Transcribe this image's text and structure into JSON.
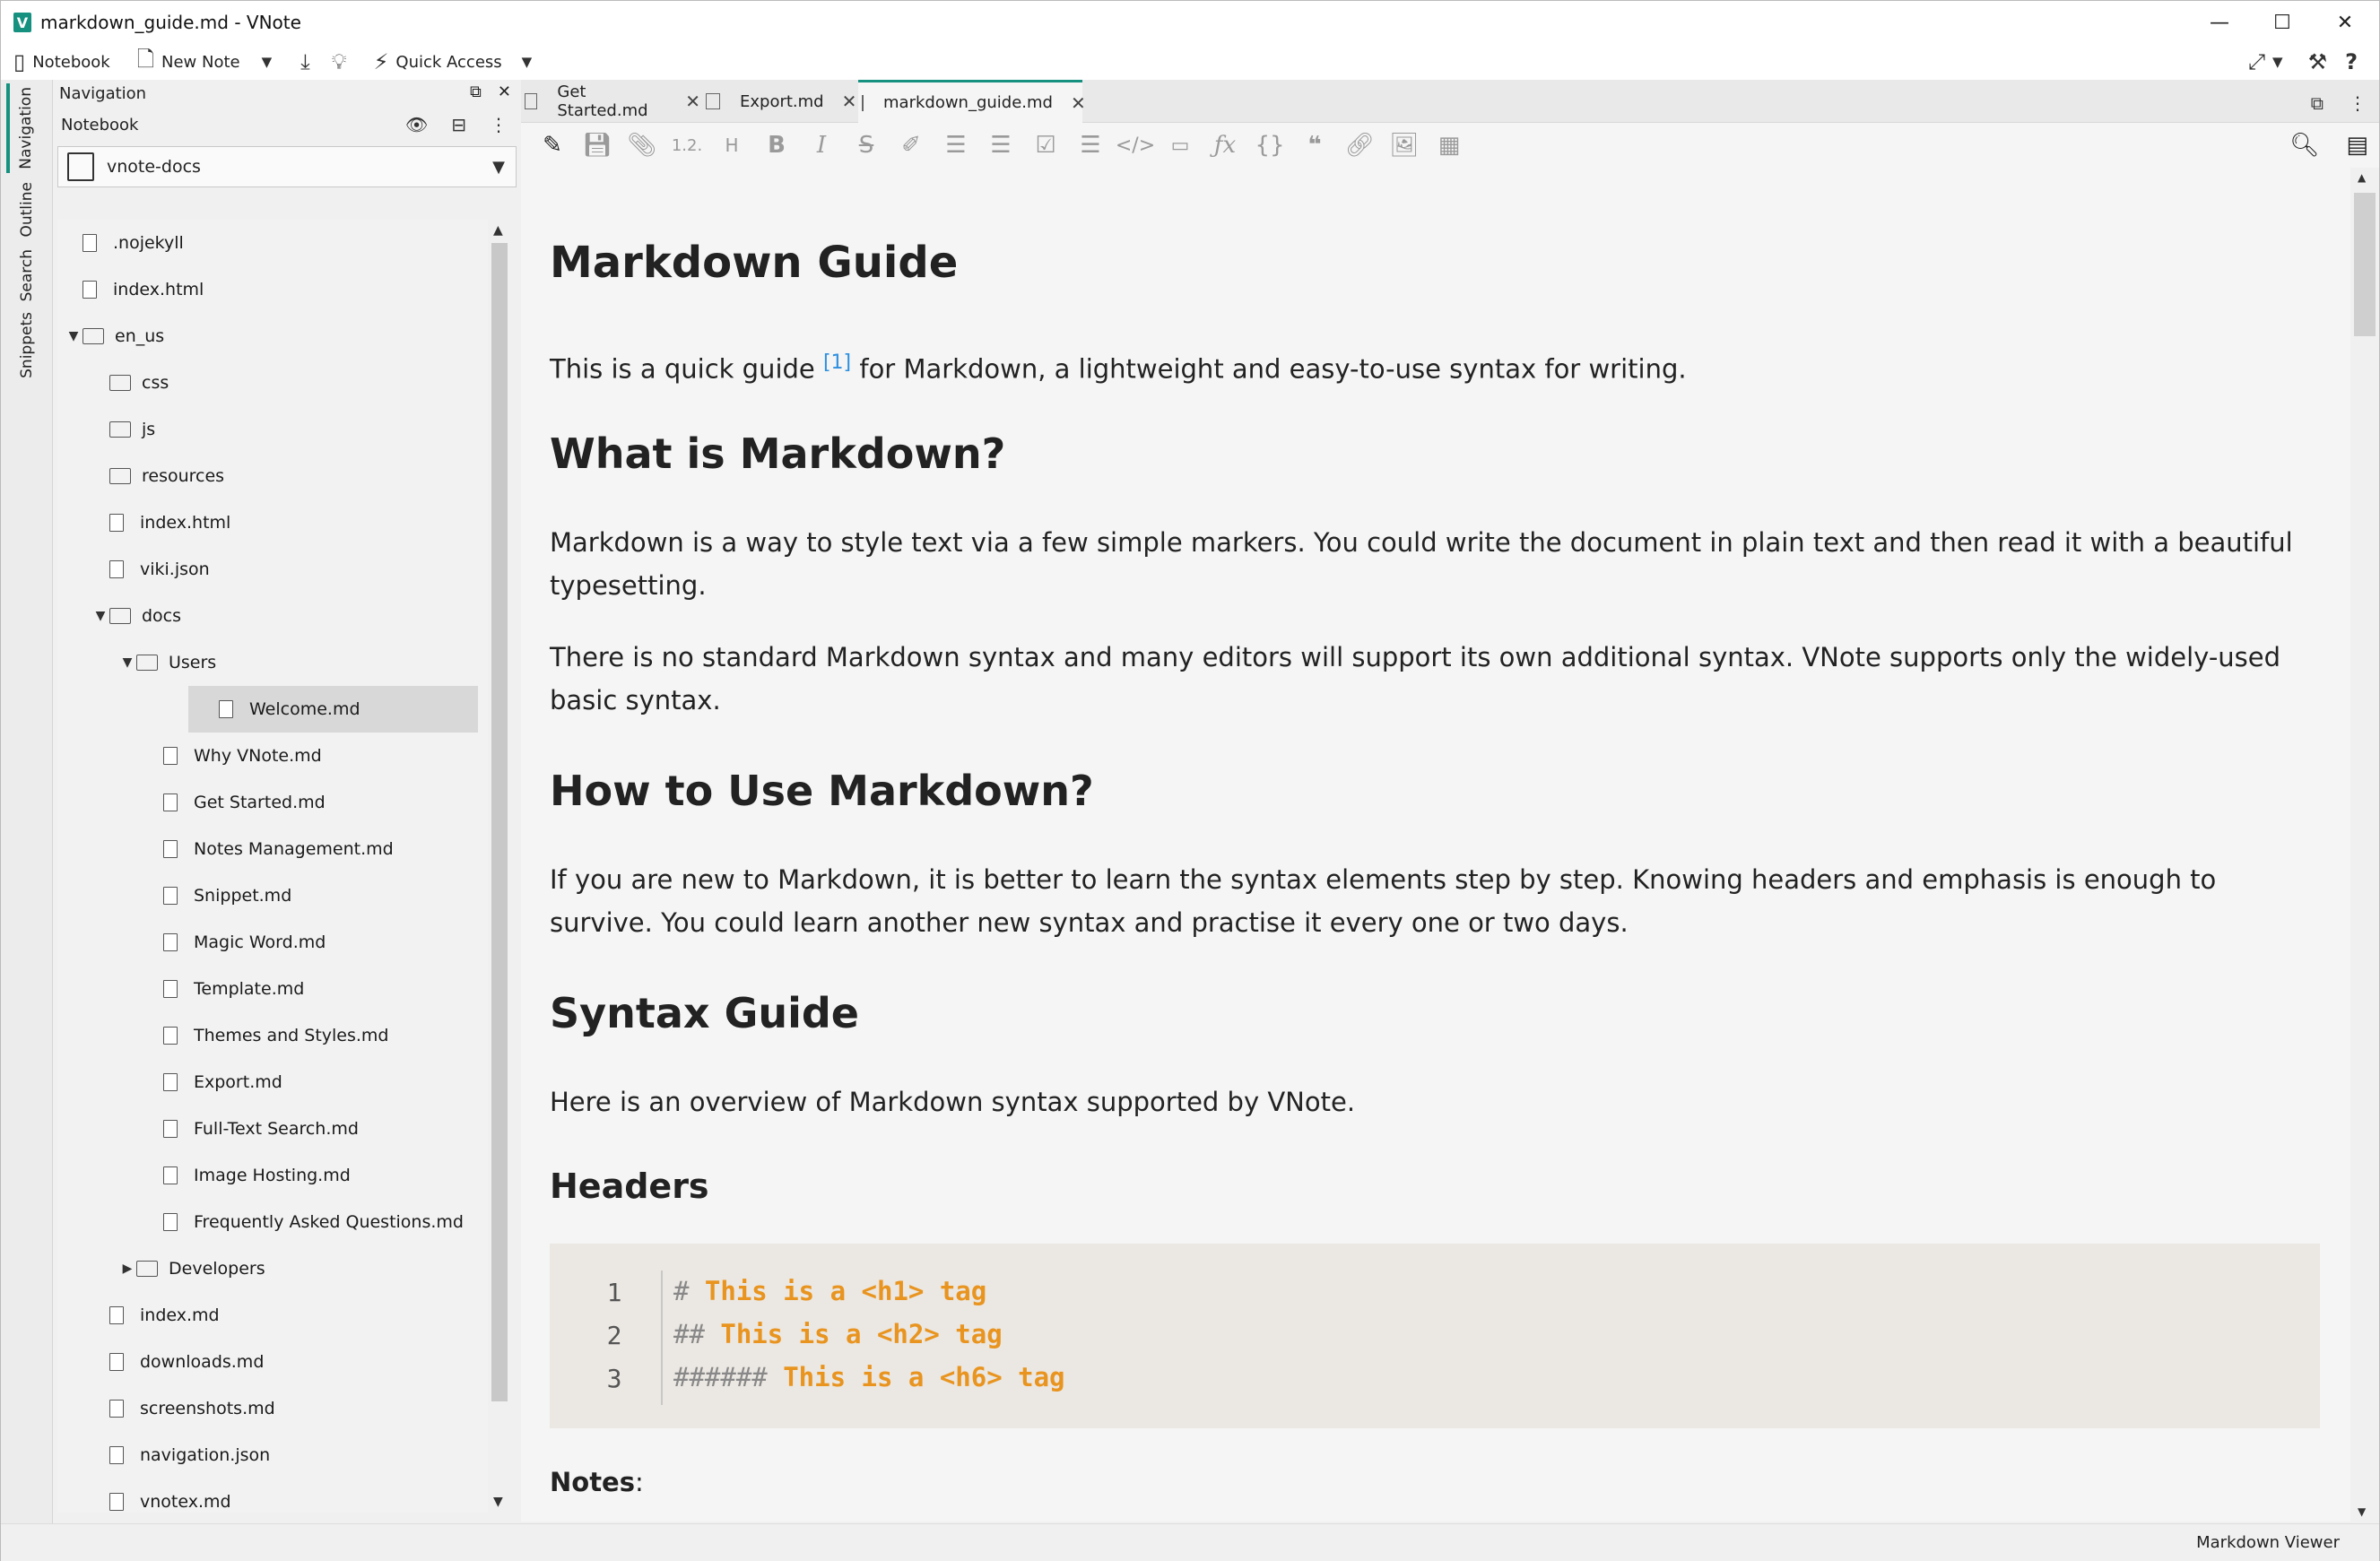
{
  "window": {
    "title": "markdown_guide.md - VNote",
    "logo": "V"
  },
  "window_controls": {
    "minimize": "—",
    "maximize": "☐",
    "close": "✕"
  },
  "toolbar": {
    "notebook": "Notebook",
    "new_note": "New Note",
    "quick_access": "Quick Access"
  },
  "activity": [
    "Navigation",
    "Outline",
    "Search",
    "Snippets"
  ],
  "navigation": {
    "title": "Navigation",
    "section": "Notebook",
    "selected_notebook": "vnote-docs",
    "tree": [
      {
        "label": ".nojekyll",
        "type": "file",
        "depth": 0
      },
      {
        "label": "index.html",
        "type": "file",
        "depth": 0
      },
      {
        "label": "en_us",
        "type": "folder",
        "depth": 0,
        "expanded": true
      },
      {
        "label": "css",
        "type": "folder",
        "depth": 1
      },
      {
        "label": "js",
        "type": "folder",
        "depth": 1
      },
      {
        "label": "resources",
        "type": "folder",
        "depth": 1
      },
      {
        "label": "index.html",
        "type": "file",
        "depth": 1
      },
      {
        "label": "viki.json",
        "type": "file",
        "depth": 1
      },
      {
        "label": "docs",
        "type": "folder",
        "depth": 1,
        "expanded": true
      },
      {
        "label": "Users",
        "type": "folder",
        "depth": 2,
        "expanded": true
      },
      {
        "label": "Welcome.md",
        "type": "file",
        "depth": 3,
        "selected": true
      },
      {
        "label": "Why VNote.md",
        "type": "file",
        "depth": 3
      },
      {
        "label": "Get Started.md",
        "type": "file",
        "depth": 3
      },
      {
        "label": "Notes Management.md",
        "type": "file",
        "depth": 3
      },
      {
        "label": "Snippet.md",
        "type": "file",
        "depth": 3
      },
      {
        "label": "Magic Word.md",
        "type": "file",
        "depth": 3
      },
      {
        "label": "Template.md",
        "type": "file",
        "depth": 3
      },
      {
        "label": "Themes and Styles.md",
        "type": "file",
        "depth": 3
      },
      {
        "label": "Export.md",
        "type": "file",
        "depth": 3
      },
      {
        "label": "Full-Text Search.md",
        "type": "file",
        "depth": 3
      },
      {
        "label": "Image Hosting.md",
        "type": "file",
        "depth": 3
      },
      {
        "label": "Frequently Asked Questions.md",
        "type": "file",
        "depth": 3
      },
      {
        "label": "Developers",
        "type": "folder",
        "depth": 2,
        "expanded": false
      },
      {
        "label": "index.md",
        "type": "file",
        "depth": 1
      },
      {
        "label": "downloads.md",
        "type": "file",
        "depth": 1
      },
      {
        "label": "screenshots.md",
        "type": "file",
        "depth": 1
      },
      {
        "label": "navigation.json",
        "type": "file",
        "depth": 1
      },
      {
        "label": "vnotex.md",
        "type": "file",
        "depth": 1
      }
    ]
  },
  "tabs": [
    {
      "label": "Get Started.md",
      "active": false
    },
    {
      "label": "Export.md",
      "active": false
    },
    {
      "label": "markdown_guide.md",
      "active": true
    }
  ],
  "editor_toolbar": {
    "heading_sequence": "1.2.",
    "heading": "H"
  },
  "document": {
    "h1": "Markdown Guide",
    "intro_before": "This is a quick guide ",
    "intro_footnote": "[1]",
    "intro_after": " for Markdown, a lightweight and easy-to-use syntax for writing.",
    "what_heading": "What is Markdown?",
    "what_p1": "Markdown is a way to style text via a few simple markers. You could write the document in plain text and then read it with a beautiful typesetting.",
    "what_p2": "There is no standard Markdown syntax and many editors will support its own additional syntax. VNote supports only the widely-used basic syntax.",
    "how_heading": "How to Use Markdown?",
    "how_p": "If you are new to Markdown, it is better to learn the syntax elements step by step. Knowing headers and emphasis is enough to survive. You could learn another new syntax and practise it every one or two days.",
    "syntax_heading": "Syntax Guide",
    "syntax_p": "Here is an overview of Markdown syntax supported by VNote.",
    "headers_heading": "Headers",
    "code_lines": [
      {
        "num": "1",
        "marker": "#",
        "text": " This is a <h1> tag"
      },
      {
        "num": "2",
        "marker": "##",
        "text": " This is a <h2> tag"
      },
      {
        "num": "3",
        "marker": "######",
        "text": " This is a <h6> tag"
      }
    ],
    "notes_label": "Notes",
    "notes_colon": ":"
  },
  "status": {
    "mode": "Markdown Viewer"
  },
  "colors": {
    "accent": "#16907f",
    "footnote": "#2d8fe0",
    "code_text": "#e8941f",
    "code_bg": "#ebe7e2"
  }
}
